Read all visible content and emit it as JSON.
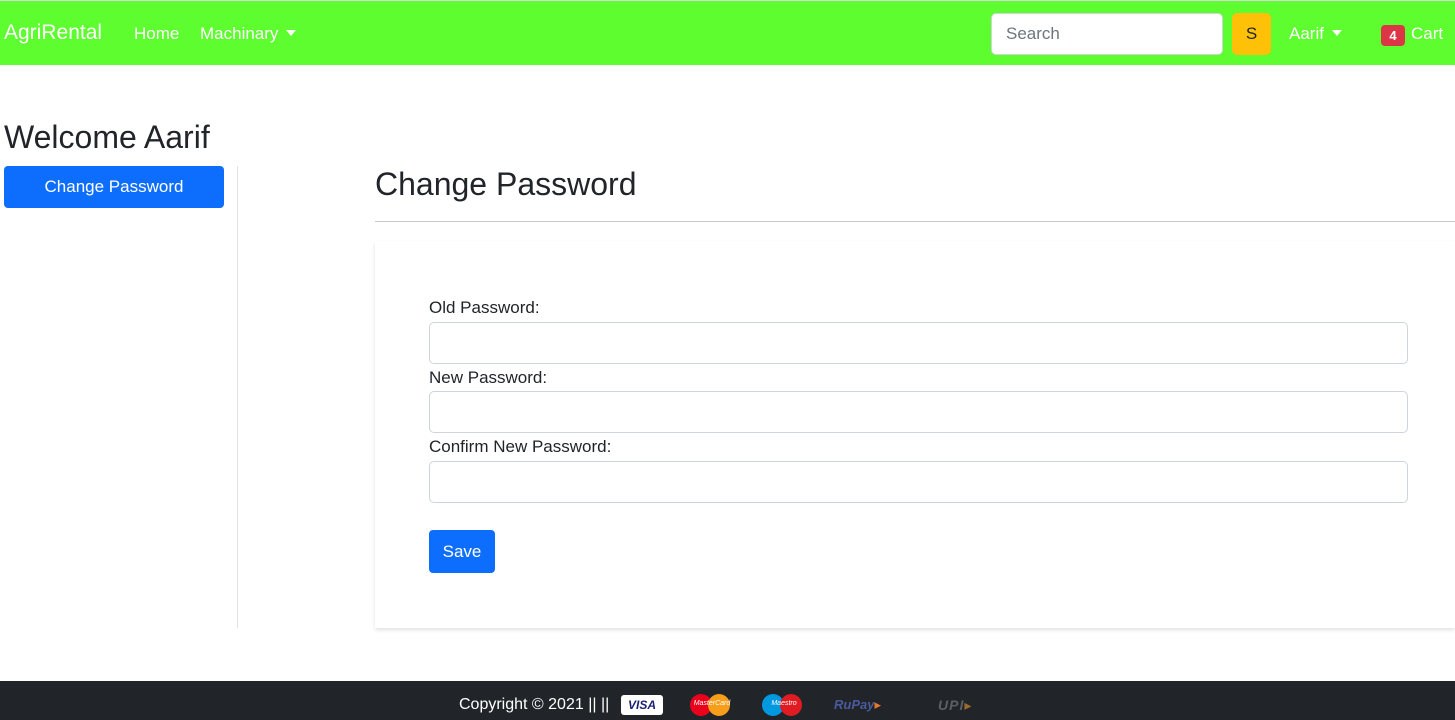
{
  "navbar": {
    "brand": "AgriRental",
    "home": "Home",
    "machinary": "Machinary",
    "search_placeholder": "Search",
    "search_button": "S",
    "user": "Aarif",
    "cart_count": "4",
    "cart": "Cart",
    "background_color": "#5dfd2f"
  },
  "sidebar": {
    "welcome": "Welcome Aarif",
    "change_password_button": "Change Password"
  },
  "main": {
    "title": "Change Password",
    "fields": [
      {
        "label": "Old Password:",
        "value": ""
      },
      {
        "label": "New Password:",
        "value": ""
      },
      {
        "label": "Confirm New Password:",
        "value": ""
      }
    ],
    "save_button": "Save",
    "accent_color": "#0d6efd"
  },
  "footer": {
    "copyright": "Copyright © 2021 || ||",
    "payment_icons": {
      "visa": "VISA",
      "mastercard": "MasterCard",
      "maestro": "Maestro",
      "rupay": "RuPay",
      "upi": "UPI"
    }
  }
}
